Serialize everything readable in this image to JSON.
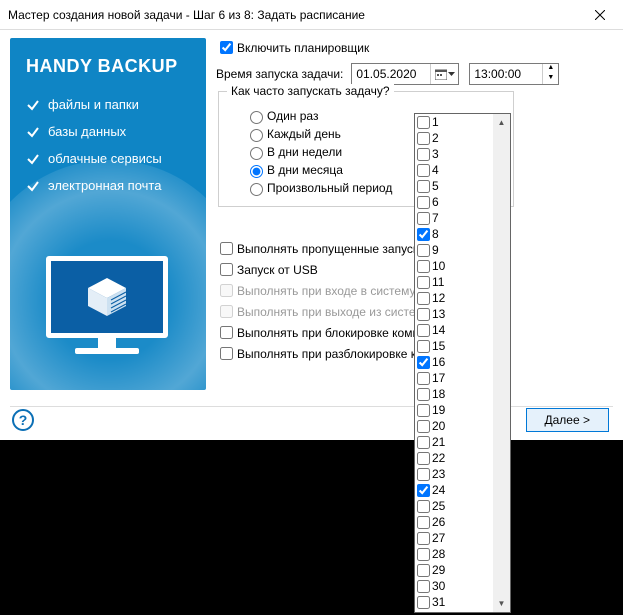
{
  "window": {
    "title": "Мастер создания новой задачи - Шаг 6 из 8: Задать расписание"
  },
  "sidebar": {
    "brand": "HANDY BACKUP",
    "features": [
      "файлы и папки",
      "базы данных",
      "облачные сервисы",
      "электронная почта"
    ]
  },
  "scheduler": {
    "enable_label": "Включить планировщик",
    "enable_checked": true,
    "launch_time_label": "Время запуска задачи:",
    "date_value": "01.05.2020",
    "time_value": "13:00:00",
    "frequency_legend": "Как часто запускать задачу?",
    "options": [
      {
        "label": "Один раз",
        "checked": false
      },
      {
        "label": "Каждый день",
        "checked": false
      },
      {
        "label": "В дни недели",
        "checked": false
      },
      {
        "label": "В дни месяца",
        "checked": true
      },
      {
        "label": "Произвольный период",
        "checked": false
      }
    ]
  },
  "checks": {
    "missed": {
      "label": "Выполнять пропущенные запуски",
      "checked": false,
      "enabled": true
    },
    "usb": {
      "label": "Запуск от USB",
      "checked": false,
      "enabled": true
    },
    "login": {
      "label": "Выполнять при входе в систему",
      "checked": false,
      "enabled": false
    },
    "logout": {
      "label": "Выполнять при выходе из системы",
      "checked": false,
      "enabled": false
    },
    "lock": {
      "label": "Выполнять при блокировке компьютера",
      "checked": false,
      "enabled": true
    },
    "unlock": {
      "label": "Выполнять при разблокировке компьютера",
      "checked": false,
      "enabled": true
    }
  },
  "footer": {
    "next_label": "Далее >"
  },
  "days": [
    {
      "n": 1,
      "checked": false
    },
    {
      "n": 2,
      "checked": false
    },
    {
      "n": 3,
      "checked": false
    },
    {
      "n": 4,
      "checked": false
    },
    {
      "n": 5,
      "checked": false
    },
    {
      "n": 6,
      "checked": false
    },
    {
      "n": 7,
      "checked": false
    },
    {
      "n": 8,
      "checked": true
    },
    {
      "n": 9,
      "checked": false
    },
    {
      "n": 10,
      "checked": false
    },
    {
      "n": 11,
      "checked": false
    },
    {
      "n": 12,
      "checked": false
    },
    {
      "n": 13,
      "checked": false
    },
    {
      "n": 14,
      "checked": false
    },
    {
      "n": 15,
      "checked": false
    },
    {
      "n": 16,
      "checked": true
    },
    {
      "n": 17,
      "checked": false
    },
    {
      "n": 18,
      "checked": false
    },
    {
      "n": 19,
      "checked": false
    },
    {
      "n": 20,
      "checked": false
    },
    {
      "n": 21,
      "checked": false
    },
    {
      "n": 22,
      "checked": false
    },
    {
      "n": 23,
      "checked": false
    },
    {
      "n": 24,
      "checked": true
    },
    {
      "n": 25,
      "checked": false
    },
    {
      "n": 26,
      "checked": false
    },
    {
      "n": 27,
      "checked": false
    },
    {
      "n": 28,
      "checked": false
    },
    {
      "n": 29,
      "checked": false
    },
    {
      "n": 30,
      "checked": false
    },
    {
      "n": 31,
      "checked": false
    }
  ]
}
